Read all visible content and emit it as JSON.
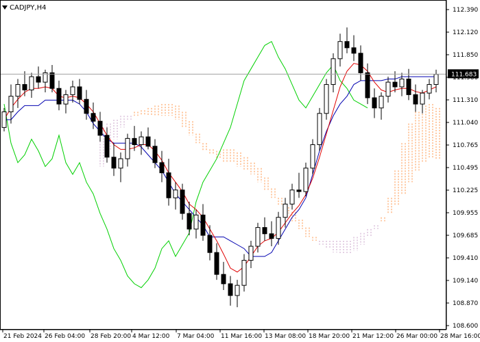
{
  "chart_data": {
    "type": "candlestick",
    "symbol_label": "CADJPY,H4",
    "current_price": 111.683,
    "current_price_label": "111.683",
    "ylim": [
      108.5,
      112.5
    ],
    "y_ticks": [
      "112.390",
      "112.120",
      "111.850",
      "111.580",
      "111.310",
      "111.040",
      "110.765",
      "110.495",
      "110.225",
      "109.955",
      "109.685",
      "109.410",
      "109.140",
      "108.870",
      "108.600"
    ],
    "x_ticks": [
      "21 Feb 2024",
      "26 Feb 04:00",
      "28 Feb 20:00",
      "4 Mar 12:00",
      "7 Mar 04:00",
      "11 Mar 16:00",
      "13 Mar 08:00",
      "18 Mar 20:00",
      "21 Mar 12:00",
      "26 Mar 00:00",
      "28 Mar 16:00"
    ],
    "colors": {
      "candle": "#000000",
      "tenkan": "#e00000",
      "kijun": "#0000b0",
      "chikou": "#00d000",
      "cloud_bull": "#ff9040",
      "cloud_bear": "#c8a0c8",
      "price_tag": "#000000",
      "price_line": "#a0a0a0"
    },
    "candles": [
      [
        111.0,
        111.25,
        110.95,
        111.2
      ],
      [
        111.2,
        111.55,
        111.05,
        111.4
      ],
      [
        111.4,
        111.62,
        111.25,
        111.55
      ],
      [
        111.55,
        111.72,
        111.4,
        111.48
      ],
      [
        111.48,
        111.7,
        111.38,
        111.65
      ],
      [
        111.65,
        111.78,
        111.5,
        111.58
      ],
      [
        111.58,
        111.74,
        111.45,
        111.7
      ],
      [
        111.7,
        111.8,
        111.45,
        111.5
      ],
      [
        111.5,
        111.6,
        111.22,
        111.3
      ],
      [
        111.3,
        111.48,
        111.18,
        111.42
      ],
      [
        111.42,
        111.6,
        111.32,
        111.52
      ],
      [
        111.52,
        111.62,
        111.3,
        111.36
      ],
      [
        111.36,
        111.48,
        111.1,
        111.18
      ],
      [
        111.18,
        111.32,
        110.98,
        111.08
      ],
      [
        111.08,
        111.2,
        110.82,
        110.9
      ],
      [
        110.9,
        111.0,
        110.55,
        110.62
      ],
      [
        110.62,
        110.8,
        110.38,
        110.48
      ],
      [
        110.48,
        110.68,
        110.3,
        110.6
      ],
      [
        110.6,
        110.92,
        110.5,
        110.86
      ],
      [
        110.86,
        111.02,
        110.7,
        110.78
      ],
      [
        110.78,
        110.95,
        110.65,
        110.88
      ],
      [
        110.88,
        111.0,
        110.72,
        110.76
      ],
      [
        110.76,
        110.85,
        110.48,
        110.55
      ],
      [
        110.55,
        110.7,
        110.3,
        110.42
      ],
      [
        110.42,
        110.6,
        110.0,
        110.1
      ],
      [
        110.1,
        110.3,
        109.95,
        110.2
      ],
      [
        110.2,
        110.28,
        109.82,
        109.9
      ],
      [
        109.9,
        110.05,
        109.62,
        109.7
      ],
      [
        109.7,
        109.95,
        109.58,
        109.88
      ],
      [
        109.88,
        110.02,
        109.55,
        109.62
      ],
      [
        109.62,
        109.75,
        109.3,
        109.4
      ],
      [
        109.4,
        109.52,
        109.05,
        109.12
      ],
      [
        109.12,
        109.28,
        108.92,
        109.0
      ],
      [
        109.0,
        109.1,
        108.72,
        108.85
      ],
      [
        108.85,
        109.05,
        108.7,
        108.98
      ],
      [
        108.98,
        109.38,
        108.9,
        109.3
      ],
      [
        109.3,
        109.55,
        109.2,
        109.48
      ],
      [
        109.48,
        109.78,
        109.4,
        109.72
      ],
      [
        109.72,
        109.85,
        109.55,
        109.64
      ],
      [
        109.64,
        109.8,
        109.48,
        109.58
      ],
      [
        109.58,
        109.92,
        109.5,
        109.85
      ],
      [
        109.85,
        110.1,
        109.72,
        110.02
      ],
      [
        110.02,
        110.28,
        109.95,
        110.2
      ],
      [
        110.2,
        110.42,
        110.1,
        110.18
      ],
      [
        110.18,
        110.55,
        110.12,
        110.48
      ],
      [
        110.48,
        110.85,
        110.4,
        110.78
      ],
      [
        110.78,
        111.25,
        110.7,
        111.18
      ],
      [
        111.18,
        111.62,
        111.1,
        111.55
      ],
      [
        111.55,
        111.95,
        111.45,
        111.88
      ],
      [
        111.88,
        112.2,
        111.78,
        112.1
      ],
      [
        112.1,
        112.28,
        111.95,
        112.02
      ],
      [
        112.02,
        112.18,
        111.85,
        111.95
      ],
      [
        111.95,
        112.05,
        111.6,
        111.7
      ],
      [
        111.7,
        111.82,
        111.3,
        111.38
      ],
      [
        111.38,
        111.5,
        111.12,
        111.25
      ],
      [
        111.25,
        111.45,
        111.1,
        111.4
      ],
      [
        111.4,
        111.65,
        111.32,
        111.58
      ],
      [
        111.58,
        111.72,
        111.45,
        111.52
      ],
      [
        111.52,
        111.7,
        111.4,
        111.62
      ],
      [
        111.62,
        111.75,
        111.35,
        111.42
      ],
      [
        111.42,
        111.55,
        111.2,
        111.3
      ],
      [
        111.3,
        111.48,
        111.18,
        111.44
      ],
      [
        111.44,
        111.62,
        111.36,
        111.55
      ],
      [
        111.55,
        111.74,
        111.45,
        111.68
      ]
    ],
    "tenkan": [
      111.1,
      111.25,
      111.36,
      111.45,
      111.5,
      111.5,
      111.52,
      111.5,
      111.4,
      111.38,
      111.4,
      111.38,
      111.3,
      111.2,
      111.05,
      110.9,
      110.78,
      110.72,
      110.72,
      110.74,
      110.78,
      110.78,
      110.7,
      110.58,
      110.42,
      110.3,
      110.18,
      110.02,
      109.95,
      109.85,
      109.7,
      109.55,
      109.38,
      109.2,
      109.15,
      109.22,
      109.35,
      109.48,
      109.55,
      109.58,
      109.66,
      109.78,
      109.9,
      110.0,
      110.14,
      110.35,
      110.62,
      110.92,
      111.22,
      111.52,
      111.72,
      111.82,
      111.8,
      111.72,
      111.58,
      111.48,
      111.45,
      111.48,
      111.5,
      111.5,
      111.46,
      111.44,
      111.48,
      111.52
    ],
    "kijun": [
      111.1,
      111.1,
      111.2,
      111.28,
      111.28,
      111.28,
      111.35,
      111.35,
      111.35,
      111.35,
      111.35,
      111.3,
      111.2,
      111.05,
      110.95,
      110.85,
      110.8,
      110.8,
      110.8,
      110.8,
      110.75,
      110.65,
      110.55,
      110.45,
      110.3,
      110.15,
      110.05,
      109.95,
      109.85,
      109.75,
      109.6,
      109.6,
      109.6,
      109.55,
      109.5,
      109.45,
      109.35,
      109.35,
      109.35,
      109.4,
      109.55,
      109.7,
      109.85,
      109.95,
      110.1,
      110.4,
      110.7,
      110.95,
      111.15,
      111.3,
      111.4,
      111.55,
      111.6,
      111.6,
      111.6,
      111.6,
      111.62,
      111.62,
      111.65,
      111.65,
      111.65,
      111.65,
      111.65,
      111.65
    ],
    "chikou": [
      111.3,
      110.8,
      110.55,
      110.65,
      110.85,
      110.7,
      110.5,
      110.6,
      110.9,
      110.55,
      110.4,
      110.55,
      110.3,
      110.15,
      109.9,
      109.7,
      109.45,
      109.3,
      109.1,
      109.0,
      108.95,
      109.05,
      109.2,
      109.45,
      109.55,
      109.35,
      109.5,
      109.65,
      110.05,
      110.3,
      110.45,
      110.6,
      110.8,
      111.0,
      111.3,
      111.6,
      111.75,
      111.9,
      112.05,
      112.1,
      111.9,
      111.75,
      111.55,
      111.35,
      111.25,
      111.4,
      111.55,
      111.7,
      111.8,
      111.6,
      111.5,
      111.35,
      111.3,
      111.25
    ],
    "senkou_a": [
      110.5,
      110.7,
      110.85,
      111.0,
      111.1,
      111.2,
      111.22,
      111.25,
      111.28,
      111.3,
      111.3,
      111.28,
      111.2,
      111.08,
      110.92,
      110.8,
      110.72,
      110.7,
      110.72,
      110.72,
      110.68,
      110.62,
      110.55,
      110.48,
      110.36,
      110.22,
      110.1,
      109.98,
      109.92,
      109.82,
      109.72,
      109.6,
      109.5,
      109.45,
      109.4,
      109.38,
      109.38,
      109.42,
      109.5,
      109.6,
      109.7,
      109.85,
      110.1,
      110.45,
      110.8,
      111.05,
      111.2,
      111.28,
      111.3,
      111.25
    ],
    "senkou_b": [
      111.0,
      111.05,
      111.1,
      111.15,
      111.15,
      111.15,
      111.15,
      111.15,
      111.15,
      111.15,
      111.15,
      111.1,
      111.0,
      110.9,
      110.8,
      110.7,
      110.65,
      110.6,
      110.55,
      110.55,
      110.5,
      110.45,
      110.4,
      110.3,
      110.2,
      110.1,
      110.0,
      109.9,
      109.8,
      109.7,
      109.6,
      109.55,
      109.55,
      109.55,
      109.55,
      109.55,
      109.55,
      109.6,
      109.65,
      109.7,
      109.75,
      109.8,
      109.9,
      110.0,
      110.15,
      110.3,
      110.45,
      110.55,
      110.6,
      110.6
    ]
  }
}
